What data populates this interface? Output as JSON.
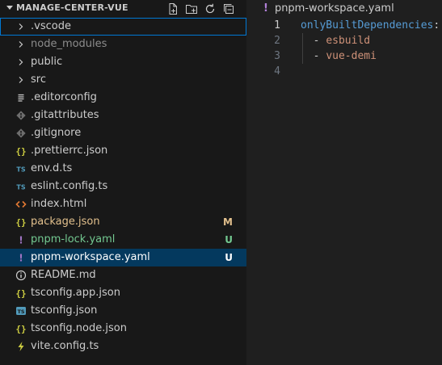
{
  "explorer": {
    "title": "MANAGE-CENTER-VUE",
    "actions": [
      {
        "name": "new-file-icon",
        "icon": "new-file"
      },
      {
        "name": "new-folder-icon",
        "icon": "new-folder"
      },
      {
        "name": "refresh-icon",
        "icon": "refresh"
      },
      {
        "name": "collapse-all-icon",
        "icon": "collapse-all"
      }
    ],
    "items": [
      {
        "label": ".vscode",
        "type": "folder",
        "focused": true
      },
      {
        "label": "node_modules",
        "type": "folder",
        "dimmed": true
      },
      {
        "label": "public",
        "type": "folder"
      },
      {
        "label": "src",
        "type": "folder"
      },
      {
        "label": ".editorconfig",
        "type": "file",
        "icon": "lines",
        "icon_color": "#cccccc"
      },
      {
        "label": ".gitattributes",
        "type": "file",
        "icon": "git",
        "icon_color": "#6d6d6d"
      },
      {
        "label": ".gitignore",
        "type": "file",
        "icon": "git",
        "icon_color": "#6d6d6d"
      },
      {
        "label": ".prettierrc.json",
        "type": "file",
        "icon": "braces",
        "icon_color": "#cbcb41"
      },
      {
        "label": "env.d.ts",
        "type": "file",
        "icon": "ts",
        "icon_color": "#519aba"
      },
      {
        "label": "eslint.config.ts",
        "type": "file",
        "icon": "ts",
        "icon_color": "#519aba"
      },
      {
        "label": "index.html",
        "type": "file",
        "icon": "html",
        "icon_color": "#e37933"
      },
      {
        "label": "package.json",
        "type": "file",
        "icon": "braces",
        "icon_color": "#cbcb41",
        "label_color": "#e2c08d",
        "badge": "M",
        "badge_color": "#e2c08d"
      },
      {
        "label": "pnpm-lock.yaml",
        "type": "file",
        "icon": "yaml",
        "icon_color": "#a074c4",
        "label_color": "#73c991",
        "badge": "U",
        "badge_color": "#73c991"
      },
      {
        "label": "pnpm-workspace.yaml",
        "type": "file",
        "icon": "yaml",
        "icon_color": "#a074c4",
        "selected": true,
        "badge": "U",
        "badge_color": "#ffffff"
      },
      {
        "label": "README.md",
        "type": "file",
        "icon": "info",
        "icon_color": "#cccccc"
      },
      {
        "label": "tsconfig.app.json",
        "type": "file",
        "icon": "braces",
        "icon_color": "#cbcb41"
      },
      {
        "label": "tsconfig.json",
        "type": "file",
        "icon": "tsconfig",
        "icon_color": "#519aba"
      },
      {
        "label": "tsconfig.node.json",
        "type": "file",
        "icon": "braces",
        "icon_color": "#cbcb41"
      },
      {
        "label": "vite.config.ts",
        "type": "file",
        "icon": "vite",
        "icon_color": "#cbcb41"
      }
    ]
  },
  "editor": {
    "breadcrumb": "pnpm-workspace.yaml",
    "active_line": 1,
    "lines": [
      {
        "num": "1",
        "tokens": [
          {
            "text": "onlyBuiltDependencies",
            "color": "#569cd6"
          },
          {
            "text": ":",
            "color": "#cccccc"
          }
        ]
      },
      {
        "num": "2",
        "tokens": [
          {
            "text": "  - ",
            "color": "#cccccc"
          },
          {
            "text": "esbuild",
            "color": "#ce9178"
          }
        ]
      },
      {
        "num": "3",
        "tokens": [
          {
            "text": "  - ",
            "color": "#cccccc"
          },
          {
            "text": "vue-demi",
            "color": "#ce9178"
          }
        ]
      },
      {
        "num": "4",
        "tokens": []
      }
    ]
  }
}
